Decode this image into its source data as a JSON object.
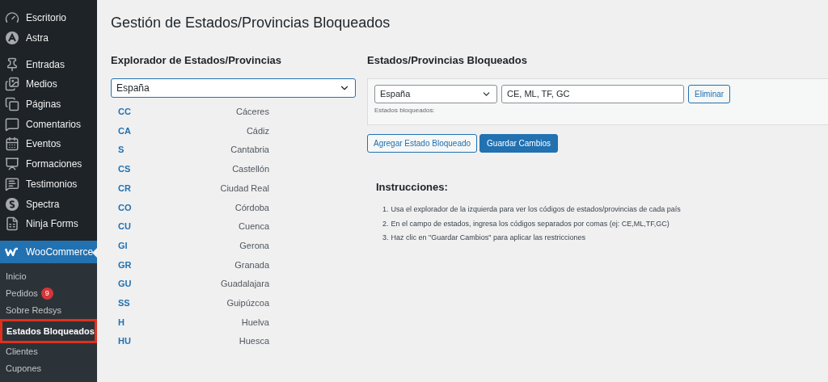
{
  "sidebar": {
    "items": [
      {
        "label": "Escritorio",
        "selected": false
      },
      {
        "label": "Astra",
        "selected": false
      },
      {
        "label": "Entradas",
        "selected": false
      },
      {
        "label": "Medios",
        "selected": false
      },
      {
        "label": "Páginas",
        "selected": false
      },
      {
        "label": "Comentarios",
        "selected": false
      },
      {
        "label": "Eventos",
        "selected": false
      },
      {
        "label": "Formaciones",
        "selected": false
      },
      {
        "label": "Testimonios",
        "selected": false
      },
      {
        "label": "Spectra",
        "selected": false
      },
      {
        "label": "Ninja Forms",
        "selected": false
      },
      {
        "label": "WooCommerce",
        "selected": true
      }
    ],
    "submenu": [
      {
        "label": "Inicio",
        "selected": false,
        "highlighted": false
      },
      {
        "label": "Pedidos",
        "badge": "9",
        "selected": false,
        "highlighted": false
      },
      {
        "label": "Sobre Redsys",
        "selected": false,
        "highlighted": false
      },
      {
        "label": "Estados Bloqueados",
        "selected": true,
        "highlighted": true
      },
      {
        "label": "Clientes",
        "selected": false,
        "highlighted": false
      },
      {
        "label": "Cupones",
        "selected": false,
        "highlighted": false
      }
    ]
  },
  "page_title": "Gestión de Estados/Provincias Bloqueados",
  "explorer": {
    "heading": "Explorador de Estados/Provincias",
    "country": "España",
    "states": [
      {
        "code": "CC",
        "name": "Cáceres"
      },
      {
        "code": "CA",
        "name": "Cádiz"
      },
      {
        "code": "S",
        "name": "Cantabria"
      },
      {
        "code": "CS",
        "name": "Castellón"
      },
      {
        "code": "CR",
        "name": "Ciudad Real"
      },
      {
        "code": "CO",
        "name": "Córdoba"
      },
      {
        "code": "CU",
        "name": "Cuenca"
      },
      {
        "code": "GI",
        "name": "Gerona"
      },
      {
        "code": "GR",
        "name": "Granada"
      },
      {
        "code": "GU",
        "name": "Guadalajara"
      },
      {
        "code": "SS",
        "name": "Guipúzcoa"
      },
      {
        "code": "H",
        "name": "Huelva"
      },
      {
        "code": "HU",
        "name": "Huesca"
      }
    ]
  },
  "blocked": {
    "heading": "Estados/Provincias Bloqueados",
    "country": "España",
    "states_value": "CE, ML, TF, GC",
    "remove_button": "Eliminar",
    "hint": "Estados bloqueados:",
    "add_button": "Agregar Estado Bloqueado",
    "save_button": "Guardar Cambios"
  },
  "instructions": {
    "heading": "Instrucciones:",
    "steps": [
      {
        "number": "1.",
        "text": "Usa el explorador de la izquierda para ver los códigos de estados/provincias de cada país"
      },
      {
        "number": "2.",
        "text": "En el campo de estados, ingresa los códigos separados por comas (ej: CE,ML,TF,GC)"
      },
      {
        "number": "3.",
        "text": "Haz clic en \"Guardar Cambios\" para aplicar las restricciones"
      }
    ]
  }
}
